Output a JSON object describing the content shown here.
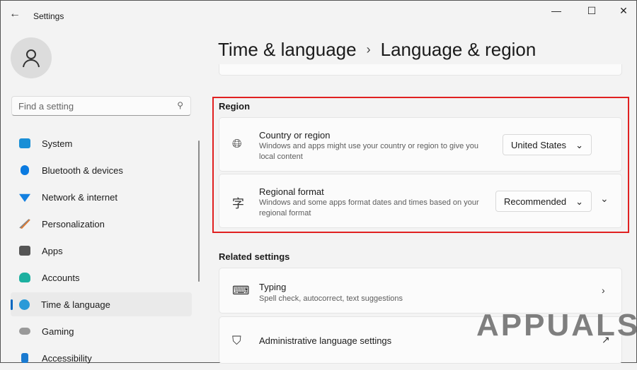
{
  "window": {
    "title": "Settings",
    "back": "←",
    "minimize": "—",
    "maximize": "☐",
    "close": "✕"
  },
  "search": {
    "placeholder": "Find a setting"
  },
  "sidebar": {
    "items": [
      {
        "label": "System",
        "color": "#1a8fd6"
      },
      {
        "label": "Bluetooth & devices",
        "color": "#0a7ae0"
      },
      {
        "label": "Network & internet",
        "color": "#1380e0"
      },
      {
        "label": "Personalization",
        "color": "#e07a30"
      },
      {
        "label": "Apps",
        "color": "#555"
      },
      {
        "label": "Accounts",
        "color": "#1db0a0"
      },
      {
        "label": "Time & language",
        "color": "#2a9ad8"
      },
      {
        "label": "Gaming",
        "color": "#999"
      },
      {
        "label": "Accessibility",
        "color": "#1a7ad0"
      }
    ]
  },
  "breadcrumb": {
    "parent": "Time & language",
    "sep": "›",
    "current": "Language & region"
  },
  "region": {
    "heading": "Region",
    "country": {
      "title": "Country or region",
      "desc": "Windows and apps might use your country or region to give you local content",
      "value": "United States"
    },
    "format": {
      "title": "Regional format",
      "desc": "Windows and some apps format dates and times based on your regional format",
      "value": "Recommended"
    }
  },
  "related": {
    "heading": "Related settings",
    "typing": {
      "title": "Typing",
      "desc": "Spell check, autocorrect, text suggestions"
    },
    "admin": {
      "title": "Administrative language settings"
    }
  },
  "watermark": "APPUALS"
}
